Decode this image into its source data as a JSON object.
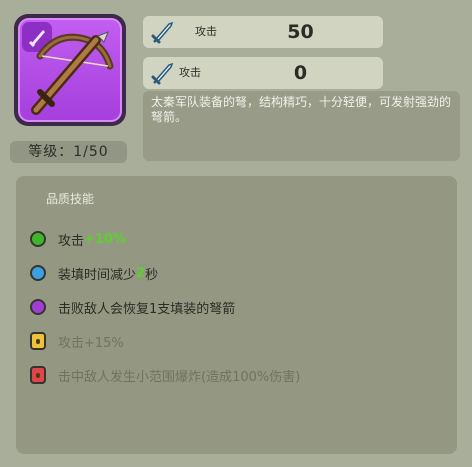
{
  "weapon": {
    "icon": "crossbow-icon",
    "level_label": "等级：1/50"
  },
  "stats": [
    {
      "icon": "sword-icon",
      "label": "攻击",
      "value": "50"
    },
    {
      "icon": "sword-icon",
      "label": "攻击",
      "value": "0"
    }
  ],
  "description": "太秦军队装备的弩，结构精巧，十分轻便，可发射强劲的弩箭。",
  "skills_panel": {
    "title": "品质技能",
    "skills": [
      {
        "color": "#3fb52d",
        "text": "攻击",
        "highlight": "+10%",
        "suffix": "",
        "locked": false
      },
      {
        "color": "#3a9fe0",
        "text": "装填时间减少",
        "highlight": "2",
        "suffix": "秒",
        "locked": false
      },
      {
        "color": "#a23ed8",
        "text": "击败敌人会恢复1支填装的弩箭",
        "highlight": "",
        "suffix": "",
        "locked": false
      },
      {
        "color": "#f0c23a",
        "text": "攻击+15%",
        "highlight": "",
        "suffix": "",
        "locked": true,
        "lock_icon": "padlock-icon"
      },
      {
        "color": "#e0454a",
        "text": "击中敌人发生小范围爆炸(造成100%伤害)",
        "highlight": "",
        "suffix": "",
        "locked": true,
        "lock_icon": "padlock-icon"
      }
    ]
  }
}
